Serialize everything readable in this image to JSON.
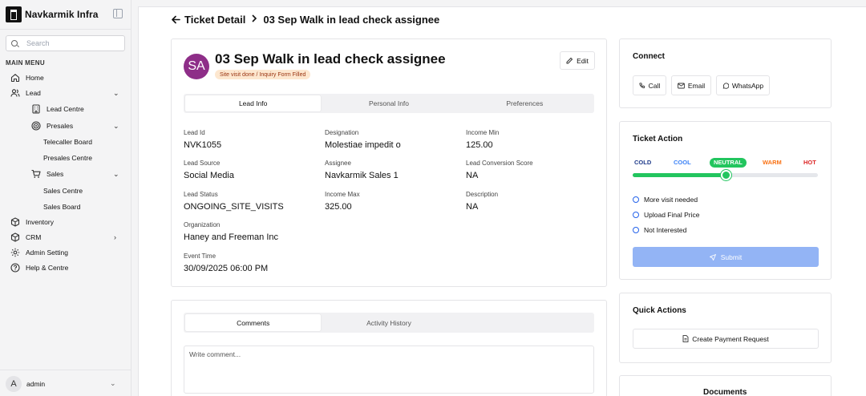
{
  "app": {
    "brand": "Navkarmik Infra"
  },
  "sidebar": {
    "search_placeholder": "Search",
    "menu_heading": "MAIN MENU",
    "items": {
      "home": "Home",
      "lead": "Lead",
      "lead_centre": "Lead Centre",
      "presales": "Presales",
      "telecaller_board": "Telecaller Board",
      "presales_centre": "Presales Centre",
      "sales": "Sales",
      "sales_centre": "Sales Centre",
      "sales_board": "Sales Board",
      "inventory": "Inventory",
      "crm": "CRM",
      "admin_setting": "Admin Setting",
      "help": "Help & Centre"
    },
    "user": {
      "initial": "A",
      "name": "admin"
    }
  },
  "breadcrumb": {
    "parent": "Ticket Detail",
    "current": "03 Sep Walk in lead check assignee"
  },
  "ticket": {
    "avatar_initials": "SA",
    "title": "03 Sep Walk in lead check assignee",
    "badge": "Site visit done / Inquiry Form Filled",
    "edit_label": "Edit",
    "tabs": [
      "Lead Info",
      "Personal Info",
      "Preferences"
    ],
    "active_tab": "Lead Info"
  },
  "lead_info": {
    "lead_id": {
      "label": "Lead Id",
      "value": "NVK1055"
    },
    "designation": {
      "label": "Designation",
      "value": "Molestiae impedit o"
    },
    "income_min": {
      "label": "Income Min",
      "value": "125.00"
    },
    "lead_source": {
      "label": "Lead Source",
      "value": "Social Media"
    },
    "assignee": {
      "label": "Assignee",
      "value": "Navkarmik Sales 1"
    },
    "conversion_score": {
      "label": "Lead Conversion Score",
      "value": "NA"
    },
    "lead_status": {
      "label": "Lead Status",
      "value": "ONGOING_SITE_VISITS"
    },
    "income_max": {
      "label": "Income Max",
      "value": "325.00"
    },
    "description": {
      "label": "Description",
      "value": "NA"
    },
    "organization": {
      "label": "Organization",
      "value": "Haney and Freeman Inc"
    },
    "event_time": {
      "label": "Event Time",
      "value": "30/09/2025 06:00 PM"
    }
  },
  "comments": {
    "tabs": [
      "Comments",
      "Activity History"
    ],
    "active_tab": "Comments",
    "placeholder": "Write comment..."
  },
  "connect": {
    "title": "Connect",
    "call": "Call",
    "email": "Email",
    "whatsapp": "WhatsApp"
  },
  "ticket_action": {
    "title": "Ticket Action",
    "levels": [
      "COLD",
      "COOL",
      "NEUTRAL",
      "WARM",
      "HOT"
    ],
    "selected_level": "NEUTRAL",
    "slider_value_percent": 50,
    "options": [
      "More visit needed",
      "Upload Final Price",
      "Not Interested"
    ],
    "submit_label": "Submit",
    "colors": {
      "cold": "#1e3a8a",
      "cool": "#3b82f6",
      "neutral": "#22c55e",
      "warm": "#f97316",
      "hot": "#dc2626"
    }
  },
  "quick_actions": {
    "title": "Quick Actions",
    "create_payment": "Create Payment Request"
  },
  "documents": {
    "title": "Documents"
  }
}
